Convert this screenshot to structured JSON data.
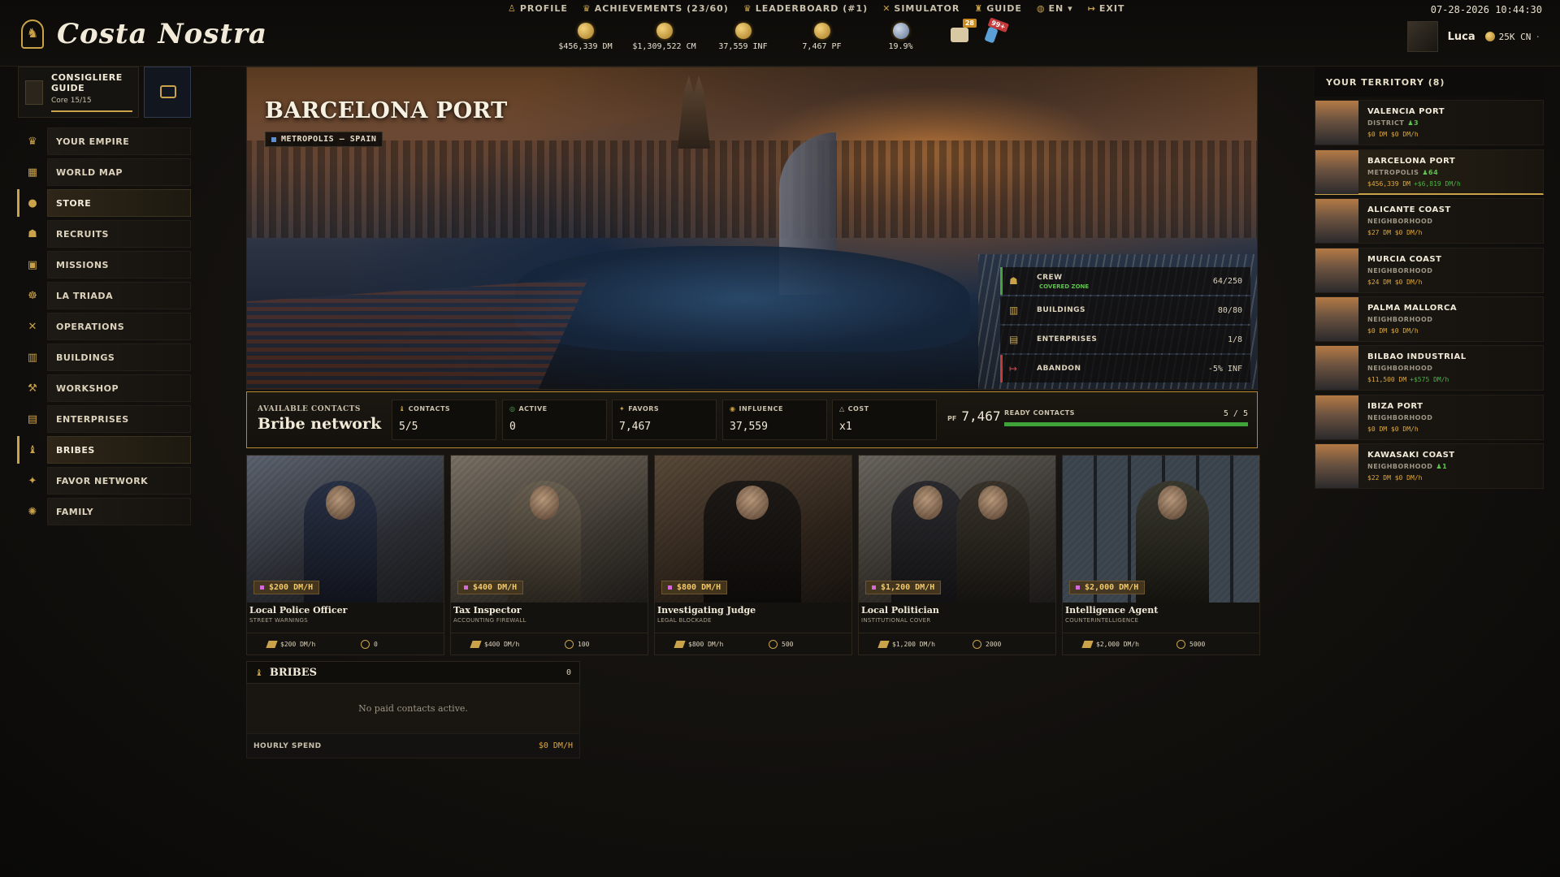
{
  "app": {
    "title": "Costa Nostra",
    "datetime": "07-28-2026 10:44:30"
  },
  "topnav": [
    {
      "label": "PROFILE",
      "icon": "person-icon"
    },
    {
      "label": "ACHIEVEMENTS",
      "extra": "(23/60)",
      "icon": "trophy-icon"
    },
    {
      "label": "LEADERBOARD",
      "extra": "(#1)",
      "icon": "trophy-icon"
    },
    {
      "label": "SIMULATOR",
      "icon": "swords-icon"
    },
    {
      "label": "GUIDE",
      "icon": "guide-icon"
    },
    {
      "label": "EN",
      "icon": "globe-icon"
    },
    {
      "label": "EXIT",
      "icon": "exit-icon"
    }
  ],
  "resources": [
    {
      "value": "$456,339 DM",
      "icon": "dirty-money-icon"
    },
    {
      "value": "$1,309,522 CM",
      "icon": "clean-money-icon"
    },
    {
      "value": "37,559 INF",
      "icon": "influence-icon"
    },
    {
      "value": "7,467 PF",
      "icon": "favor-icon"
    },
    {
      "value": "19.9%",
      "icon": "magnifier-icon"
    }
  ],
  "notifications": {
    "messages_badge": "28",
    "phone_badge": "99+"
  },
  "user": {
    "name": "Luca",
    "coins": "25K CN"
  },
  "guide": {
    "title": "CONSIGLIERE GUIDE",
    "progress": "Core 15/15",
    "progress_fraction": 1.0
  },
  "sidebar": [
    {
      "label": "YOUR EMPIRE",
      "icon": "crown-icon",
      "active": false
    },
    {
      "label": "WORLD MAP",
      "icon": "map-icon",
      "active": false
    },
    {
      "label": "STORE",
      "icon": "coin-icon",
      "active": true
    },
    {
      "label": "RECRUITS",
      "icon": "recruits-icon",
      "active": false
    },
    {
      "label": "MISSIONS",
      "icon": "missions-icon",
      "active": false
    },
    {
      "label": "LA TRIADA",
      "icon": "triad-icon",
      "active": false
    },
    {
      "label": "OPERATIONS",
      "icon": "crossed-swords-icon",
      "active": false
    },
    {
      "label": "BUILDINGS",
      "icon": "building-icon",
      "active": false
    },
    {
      "label": "WORKSHOP",
      "icon": "workshop-icon",
      "active": false
    },
    {
      "label": "ENTERPRISES",
      "icon": "enterprise-icon",
      "active": false
    },
    {
      "label": "BRIBES",
      "icon": "bribe-icon",
      "active": true
    },
    {
      "label": "FAVOR NETWORK",
      "icon": "favor-icon",
      "active": false
    },
    {
      "label": "FAMILY",
      "icon": "family-icon",
      "active": false
    }
  ],
  "hero": {
    "title": "BARCELONA PORT",
    "tag": "METROPOLIS — SPAIN",
    "stats": [
      {
        "label": "CREW",
        "sub": "COVERED ZONE",
        "value": "64/250",
        "icon": "crew-icon"
      },
      {
        "label": "BUILDINGS",
        "value": "80/80",
        "icon": "building-icon"
      },
      {
        "label": "ENTERPRISES",
        "value": "1/8",
        "icon": "enterprise-icon"
      },
      {
        "label": "ABANDON",
        "value": "-5% INF",
        "icon": "abandon-icon"
      }
    ]
  },
  "contacts_bar": {
    "kicker": "AVAILABLE CONTACTS",
    "title": "Bribe network",
    "boxes": [
      {
        "label": "CONTACTS",
        "value": "5/5"
      },
      {
        "label": "ACTIVE",
        "value": "0"
      },
      {
        "label": "FAVORS",
        "value": "7,467"
      },
      {
        "label": "INFLUENCE",
        "value": "37,559"
      },
      {
        "label": "COST",
        "value": "x1"
      }
    ],
    "pf_label": "PF",
    "pf_value": "7,467",
    "ready_label": "READY CONTACTS",
    "ready_value": "5 / 5",
    "ready_fraction": 1.0
  },
  "contacts": [
    {
      "name": "Local Police Officer",
      "role": "STREET WARNINGS",
      "price": "$200 DM/H",
      "cost": "$200 DM/h",
      "influence": "0"
    },
    {
      "name": "Tax Inspector",
      "role": "ACCOUNTING FIREWALL",
      "price": "$400 DM/H",
      "cost": "$400 DM/h",
      "influence": "100"
    },
    {
      "name": "Investigating Judge",
      "role": "LEGAL BLOCKADE",
      "price": "$800 DM/H",
      "cost": "$800 DM/h",
      "influence": "500"
    },
    {
      "name": "Local Politician",
      "role": "INSTITUTIONAL COVER",
      "price": "$1,200 DM/H",
      "cost": "$1,200 DM/h",
      "influence": "2000"
    },
    {
      "name": "Intelligence Agent",
      "role": "COUNTERINTELLIGENCE",
      "price": "$2,000 DM/H",
      "cost": "$2,000 DM/h",
      "influence": "5000"
    }
  ],
  "bribes_panel": {
    "title": "BRIBES",
    "count": "0",
    "empty": "No paid contacts active.",
    "hourly_label": "HOURLY SPEND",
    "hourly_value": "$0 DM/H"
  },
  "territory": {
    "title": "YOUR TERRITORY (8)",
    "items": [
      {
        "name": "VALENCIA PORT",
        "type": "DISTRICT",
        "crew": "3",
        "money": "$0 DM",
        "income": "$0 DM/h",
        "active": false
      },
      {
        "name": "BARCELONA PORT",
        "type": "METROPOLIS",
        "crew": "64",
        "money": "$456,339 DM",
        "income": "+$6,819 DM/h",
        "active": true
      },
      {
        "name": "ALICANTE COAST",
        "type": "NEIGHBORHOOD",
        "crew": "",
        "money": "$27 DM",
        "income": "$0 DM/h",
        "active": false
      },
      {
        "name": "MURCIA COAST",
        "type": "NEIGHBORHOOD",
        "crew": "",
        "money": "$24 DM",
        "income": "$0 DM/h",
        "active": false
      },
      {
        "name": "PALMA MALLORCA",
        "type": "NEIGHBORHOOD",
        "crew": "",
        "money": "$0 DM",
        "income": "$0 DM/h",
        "active": false
      },
      {
        "name": "BILBAO INDUSTRIAL",
        "type": "NEIGHBORHOOD",
        "crew": "",
        "money": "$11,500 DM",
        "income": "+$575 DM/h",
        "active": false
      },
      {
        "name": "IBIZA PORT",
        "type": "NEIGHBORHOOD",
        "crew": "",
        "money": "$0 DM",
        "income": "$0 DM/h",
        "active": false
      },
      {
        "name": "KAWASAKI COAST",
        "type": "NEIGHBORHOOD",
        "crew": "1",
        "money": "$22 DM",
        "income": "$0 DM/h",
        "active": false
      }
    ]
  }
}
